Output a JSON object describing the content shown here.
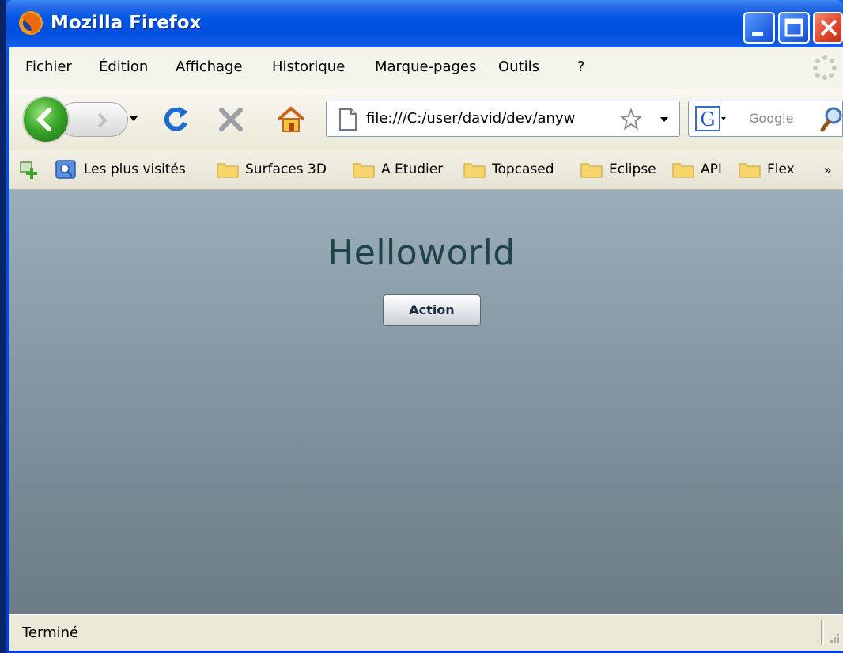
{
  "window": {
    "title": "Mozilla Firefox",
    "frame_color": "#0055e5",
    "close_color": "#e0442a"
  },
  "menu": {
    "items": [
      "Fichier",
      "Édition",
      "Affichage",
      "Historique",
      "Marque-pages",
      "Outils",
      "?"
    ]
  },
  "nav": {
    "back_icon": "back-arrow-icon",
    "forward_icon": "forward-arrow-icon",
    "reload_icon": "reload-icon",
    "stop_icon": "stop-icon",
    "home_icon": "home-icon",
    "url": "file:///C:/user/david/dev/anyw",
    "search_engine_icon": "google-icon",
    "search_placeholder": "Google"
  },
  "bookmarks": {
    "items": [
      "Les plus visités",
      "Surfaces 3D",
      "A Etudier",
      "Topcased",
      "Eclipse",
      "API",
      "Flex"
    ],
    "overflow": "»"
  },
  "page": {
    "heading": "Helloworld",
    "button_label": "Action"
  },
  "status": {
    "text": "Terminé"
  }
}
